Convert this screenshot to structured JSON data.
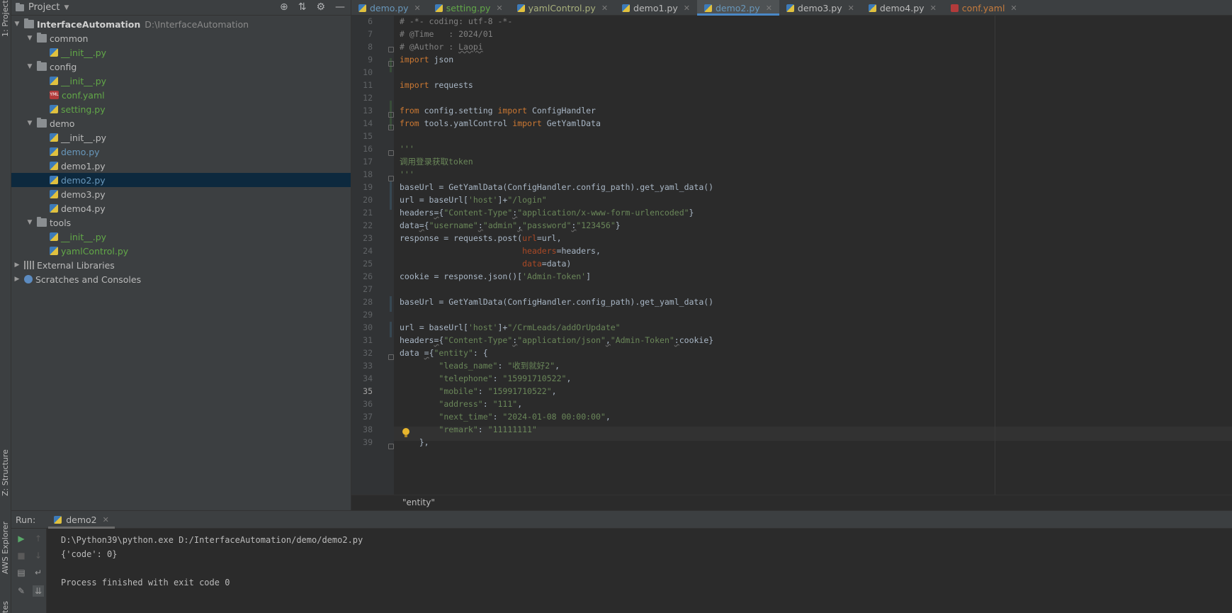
{
  "left_strip": {
    "project_tab": "1: Project",
    "structure_tab": "Z: Structure",
    "aws_tab": "AWS Explorer",
    "bottom_tab": "tes"
  },
  "project_panel": {
    "title": "Project",
    "tree": [
      {
        "label": "InterfaceAutomation",
        "path": "D:\\InterfaceAutomation",
        "type": "folder",
        "level": 0,
        "expanded": true
      },
      {
        "label": "common",
        "type": "folder",
        "level": 1,
        "expanded": true
      },
      {
        "label": "__init__.py",
        "type": "py",
        "level": 2,
        "color": "green"
      },
      {
        "label": "config",
        "type": "folder",
        "level": 1,
        "expanded": true
      },
      {
        "label": "__init__.py",
        "type": "py",
        "level": 2,
        "color": "green"
      },
      {
        "label": "conf.yaml",
        "type": "yaml",
        "level": 2,
        "color": "green"
      },
      {
        "label": "setting.py",
        "type": "py",
        "level": 2,
        "color": "green"
      },
      {
        "label": "demo",
        "type": "folder",
        "level": 1,
        "expanded": true
      },
      {
        "label": "__init__.py",
        "type": "py",
        "level": 2,
        "color": "default"
      },
      {
        "label": "demo.py",
        "type": "py",
        "level": 2,
        "color": "blue"
      },
      {
        "label": "demo1.py",
        "type": "py",
        "level": 2,
        "color": "default"
      },
      {
        "label": "demo2.py",
        "type": "py",
        "level": 2,
        "color": "blue",
        "selected": true
      },
      {
        "label": "demo3.py",
        "type": "py",
        "level": 2,
        "color": "default"
      },
      {
        "label": "demo4.py",
        "type": "py",
        "level": 2,
        "color": "default"
      },
      {
        "label": "tools",
        "type": "folder",
        "level": 1,
        "expanded": true
      },
      {
        "label": "__init__.py",
        "type": "py",
        "level": 2,
        "color": "green"
      },
      {
        "label": "yamlControl.py",
        "type": "py",
        "level": 2,
        "color": "green"
      },
      {
        "label": "External Libraries",
        "type": "lib",
        "level": 0,
        "expanded": false
      },
      {
        "label": "Scratches and Consoles",
        "type": "scratch",
        "level": 0,
        "expanded": false
      }
    ]
  },
  "tabs": [
    {
      "label": "demo.py",
      "color": "blue"
    },
    {
      "label": "setting.py",
      "color": "green"
    },
    {
      "label": "yamlControl.py",
      "color": "olive"
    },
    {
      "label": "demo1.py",
      "color": "default"
    },
    {
      "label": "demo2.py",
      "color": "blue",
      "active": true
    },
    {
      "label": "demo3.py",
      "color": "default"
    },
    {
      "label": "demo4.py",
      "color": "default"
    },
    {
      "label": "conf.yaml",
      "color": "orange",
      "yaml": true
    }
  ],
  "editor": {
    "current_line": 35,
    "lines": [
      {
        "n": 6,
        "tokens": [
          [
            "c",
            "# -*- coding: utf-8 -*-"
          ]
        ]
      },
      {
        "n": 7,
        "tokens": [
          [
            "c",
            "# @Time   : 2024/01"
          ]
        ]
      },
      {
        "n": 8,
        "tokens": [
          [
            "c",
            "# @Author : "
          ],
          [
            "cu",
            "Laopi"
          ]
        ]
      },
      {
        "n": 9,
        "tokens": [
          [
            "k",
            "import"
          ],
          [
            "t",
            " json"
          ]
        ]
      },
      {
        "n": 10,
        "tokens": []
      },
      {
        "n": 11,
        "tokens": [
          [
            "k",
            "import"
          ],
          [
            "t",
            " requests"
          ]
        ]
      },
      {
        "n": 12,
        "tokens": []
      },
      {
        "n": 13,
        "tokens": [
          [
            "k",
            "from"
          ],
          [
            "t",
            " config.setting "
          ],
          [
            "k",
            "import"
          ],
          [
            "t",
            " ConfigHandler"
          ]
        ]
      },
      {
        "n": 14,
        "tokens": [
          [
            "k",
            "from"
          ],
          [
            "t",
            " tools.yamlControl "
          ],
          [
            "k",
            "import"
          ],
          [
            "t",
            " GetYamlData"
          ]
        ]
      },
      {
        "n": 15,
        "tokens": []
      },
      {
        "n": 16,
        "tokens": [
          [
            "s",
            "'''"
          ]
        ]
      },
      {
        "n": 17,
        "tokens": [
          [
            "s",
            "调用登录获取token"
          ]
        ]
      },
      {
        "n": 18,
        "tokens": [
          [
            "s",
            "'''"
          ]
        ]
      },
      {
        "n": 19,
        "tokens": [
          [
            "t",
            "baseUrl = GetYamlData(ConfigHandler.config_path).get_yaml_data()"
          ]
        ]
      },
      {
        "n": 20,
        "tokens": [
          [
            "t",
            "url = baseUrl["
          ],
          [
            "s",
            "'host'"
          ],
          [
            "t",
            "]+"
          ],
          [
            "s",
            "\"/login\""
          ]
        ]
      },
      {
        "n": 21,
        "tokens": [
          [
            "t",
            "headers"
          ],
          [
            "tu",
            "="
          ],
          [
            "t",
            "{"
          ],
          [
            "s",
            "\"Content-Type\""
          ],
          [
            "tu",
            ":"
          ],
          [
            "s",
            "\"application/x-www-form-urlencoded\""
          ],
          [
            "t",
            "}"
          ]
        ]
      },
      {
        "n": 22,
        "tokens": [
          [
            "t",
            "data"
          ],
          [
            "tu",
            "="
          ],
          [
            "t",
            "{"
          ],
          [
            "s",
            "\"username\""
          ],
          [
            "tu",
            ":"
          ],
          [
            "s",
            "\"admin\""
          ],
          [
            "tu",
            ","
          ],
          [
            "s",
            "\"password\""
          ],
          [
            "tu",
            ":"
          ],
          [
            "s",
            "\"123456\""
          ],
          [
            "t",
            "}"
          ]
        ]
      },
      {
        "n": 23,
        "tokens": [
          [
            "t",
            "response = requests.post("
          ],
          [
            "p",
            "url"
          ],
          [
            "t",
            "=url,"
          ]
        ]
      },
      {
        "n": 24,
        "tokens": [
          [
            "t",
            "                         "
          ],
          [
            "p",
            "headers"
          ],
          [
            "t",
            "=headers,"
          ]
        ]
      },
      {
        "n": 25,
        "tokens": [
          [
            "t",
            "                         "
          ],
          [
            "p",
            "data"
          ],
          [
            "t",
            "=data)"
          ]
        ]
      },
      {
        "n": 26,
        "tokens": [
          [
            "t",
            "cookie = response.json()["
          ],
          [
            "s",
            "'Admin-Token'"
          ],
          [
            "t",
            "]"
          ]
        ]
      },
      {
        "n": 27,
        "tokens": []
      },
      {
        "n": 28,
        "tokens": [
          [
            "t",
            "baseUrl = GetYamlData(ConfigHandler.config_path).get_yaml_data()"
          ]
        ]
      },
      {
        "n": 29,
        "tokens": []
      },
      {
        "n": 30,
        "tokens": [
          [
            "t",
            "url = baseUrl["
          ],
          [
            "s",
            "'host'"
          ],
          [
            "t",
            "]+"
          ],
          [
            "s",
            "\"/CrmLeads/addOrUpdate\""
          ]
        ]
      },
      {
        "n": 31,
        "tokens": [
          [
            "t",
            "headers"
          ],
          [
            "tu",
            "="
          ],
          [
            "t",
            "{"
          ],
          [
            "s",
            "\"Content-Type\""
          ],
          [
            "tu",
            ":"
          ],
          [
            "s",
            "\"application/json\""
          ],
          [
            "tu",
            ","
          ],
          [
            "s",
            "\"Admin-Token\""
          ],
          [
            "tu",
            ":"
          ],
          [
            "t",
            "cookie}"
          ]
        ]
      },
      {
        "n": 32,
        "tokens": [
          [
            "t",
            "data "
          ],
          [
            "tu",
            "="
          ],
          [
            "t",
            "{"
          ],
          [
            "s",
            "\"entity\""
          ],
          [
            "t",
            ": {"
          ]
        ]
      },
      {
        "n": 33,
        "tokens": [
          [
            "t",
            "        "
          ],
          [
            "s",
            "\"leads_name\""
          ],
          [
            "t",
            ": "
          ],
          [
            "s",
            "\"收到就好2\""
          ],
          [
            "t",
            ","
          ]
        ]
      },
      {
        "n": 34,
        "tokens": [
          [
            "t",
            "        "
          ],
          [
            "s",
            "\"telephone\""
          ],
          [
            "t",
            ": "
          ],
          [
            "s",
            "\"15991710522\""
          ],
          [
            "t",
            ","
          ]
        ]
      },
      {
        "n": 35,
        "tokens": [
          [
            "t",
            "        "
          ],
          [
            "s",
            "\"mobile\""
          ],
          [
            "t",
            ": "
          ],
          [
            "s",
            "\"15991710522\""
          ],
          [
            "t",
            ","
          ]
        ]
      },
      {
        "n": 36,
        "tokens": [
          [
            "t",
            "        "
          ],
          [
            "s",
            "\"address\""
          ],
          [
            "t",
            ": "
          ],
          [
            "s",
            "\"111\""
          ],
          [
            "t",
            ","
          ]
        ]
      },
      {
        "n": 37,
        "tokens": [
          [
            "t",
            "        "
          ],
          [
            "s",
            "\"next_time\""
          ],
          [
            "t",
            ": "
          ],
          [
            "s",
            "\"2024-01-08 00:00:00\""
          ],
          [
            "t",
            ","
          ]
        ]
      },
      {
        "n": 38,
        "tokens": [
          [
            "t",
            "        "
          ],
          [
            "s",
            "\"remark\""
          ],
          [
            "t",
            ": "
          ],
          [
            "s",
            "\"11111111\""
          ]
        ]
      },
      {
        "n": 39,
        "tokens": [
          [
            "t",
            "    },"
          ]
        ]
      }
    ]
  },
  "breadcrumb": "\"entity\"",
  "run_panel": {
    "label": "Run:",
    "tab_label": "demo2",
    "console": [
      "D:\\Python39\\python.exe D:/InterfaceAutomation/demo/demo2.py",
      "{'code': 0}",
      "",
      "Process finished with exit code 0"
    ]
  }
}
